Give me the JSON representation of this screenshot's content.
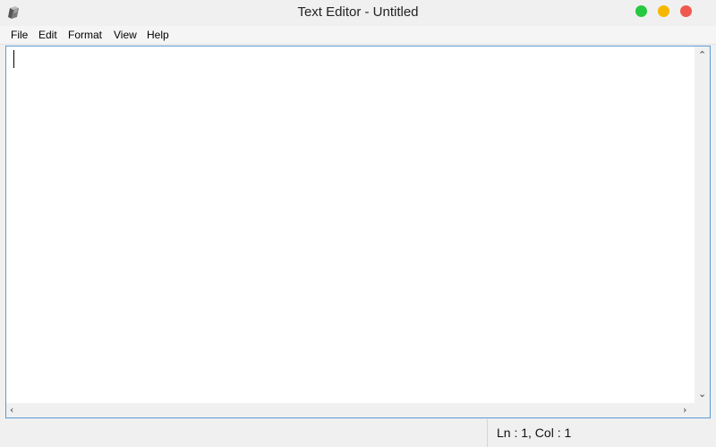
{
  "window": {
    "title": "Text Editor - Untitled",
    "app_icon": "notebook-icon",
    "controls": [
      {
        "name": "maximize",
        "color": "#27c93f"
      },
      {
        "name": "minimize",
        "color": "#f5b700"
      },
      {
        "name": "close",
        "color": "#f0584f"
      }
    ]
  },
  "menubar": {
    "items": [
      "File",
      "Edit",
      "Format",
      "View",
      "Help"
    ]
  },
  "editor": {
    "content": "",
    "focused": true,
    "border_color": "#5b9bd5"
  },
  "status": {
    "position": "Ln : 1, Col  : 1"
  }
}
